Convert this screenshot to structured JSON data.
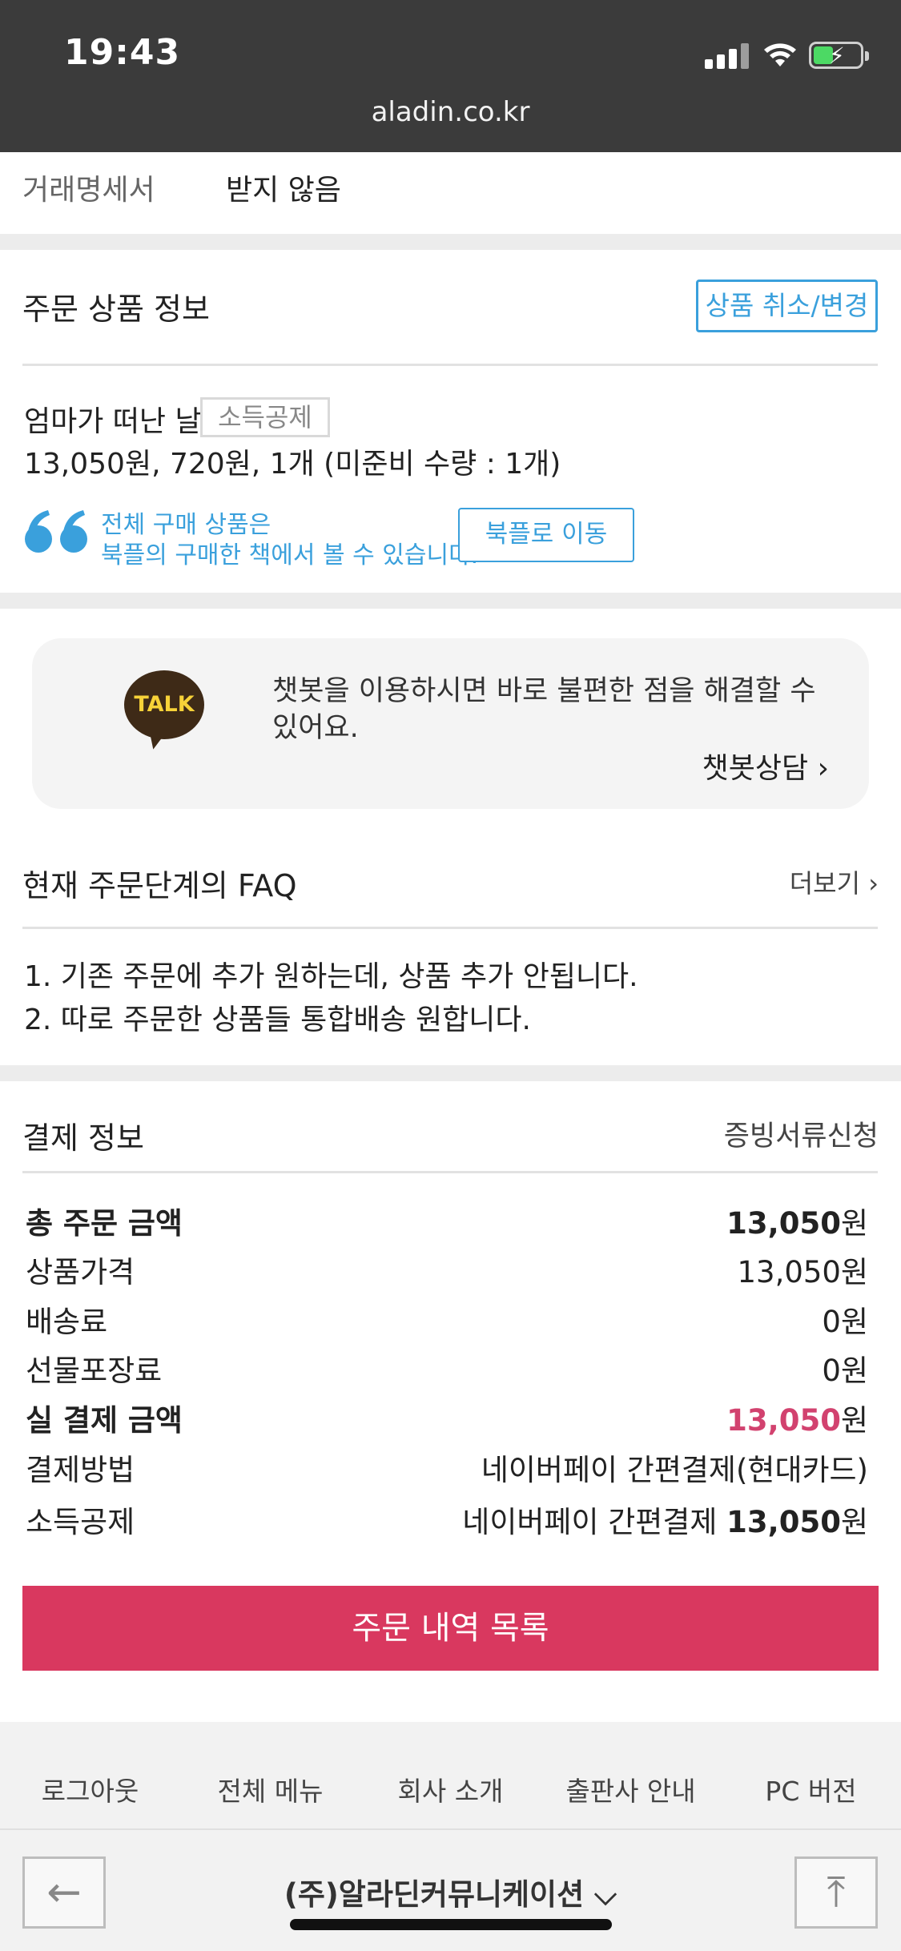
{
  "status_bar": {
    "time": "19:43",
    "url": "aladin.co.kr"
  },
  "receipt": {
    "label": "거래명세서",
    "value": "받지 않음"
  },
  "order_items": {
    "title": "주문 상품 정보",
    "cancel_button": "상품 취소/변경",
    "book_title": "엄마가 떠난 날",
    "tag": "소득공제",
    "price_line": "13,050원, 720원, 1개 (미준비 수량 : 1개)",
    "notice_line1": "전체 구매 상품은",
    "notice_line2": "북플의 구매한 책에서 볼 수 있습니다.",
    "bookple_button": "북플로 이동"
  },
  "chatbot": {
    "badge": "TALK",
    "line1": "챗봇을 이용하시면 바로 불편한 점을 해결할 수",
    "line2": "있어요.",
    "link": "챗봇상담 ›"
  },
  "faq": {
    "title": "현재 주문단계의 FAQ",
    "more": "더보기 ›",
    "items": [
      "1. 기존 주문에 추가 원하는데, 상품 추가 안됩니다.",
      "2. 따로 주문한 상품들 통합배송 원합니다."
    ]
  },
  "payment": {
    "title": "결제 정보",
    "docs_link": "증빙서류신청",
    "rows": [
      {
        "label": "총 주문 금액",
        "amount": "13,050",
        "unit": "원"
      },
      {
        "label": "상품가격",
        "amount": "13,050",
        "unit": "원"
      },
      {
        "label": "배송료",
        "amount": "0",
        "unit": "원"
      },
      {
        "label": "선물포장료",
        "amount": "0",
        "unit": "원"
      },
      {
        "label": "실 결제 금액",
        "amount": "13,050",
        "unit": "원"
      }
    ],
    "method_label": "결제방법",
    "method_value": "네이버페이 간편결제(현대카드)",
    "deduction_label": "소득공제",
    "deduction_prefix": "네이버페이 간편결제 ",
    "deduction_amount": "13,050",
    "deduction_unit": "원"
  },
  "order_list_button": "주문 내역 목록",
  "footer": {
    "menu": [
      "로그아웃",
      "전체 메뉴",
      "회사 소개",
      "출판사 안내",
      "PC 버전"
    ],
    "company": "(주)알라딘커뮤니케이션 ⌵",
    "back_icon": "←",
    "top_icon": "⤒"
  },
  "colors": {
    "accent_blue": "#3aa0dc",
    "brand_pink": "#d9385f",
    "price_pink": "#d2426f"
  }
}
